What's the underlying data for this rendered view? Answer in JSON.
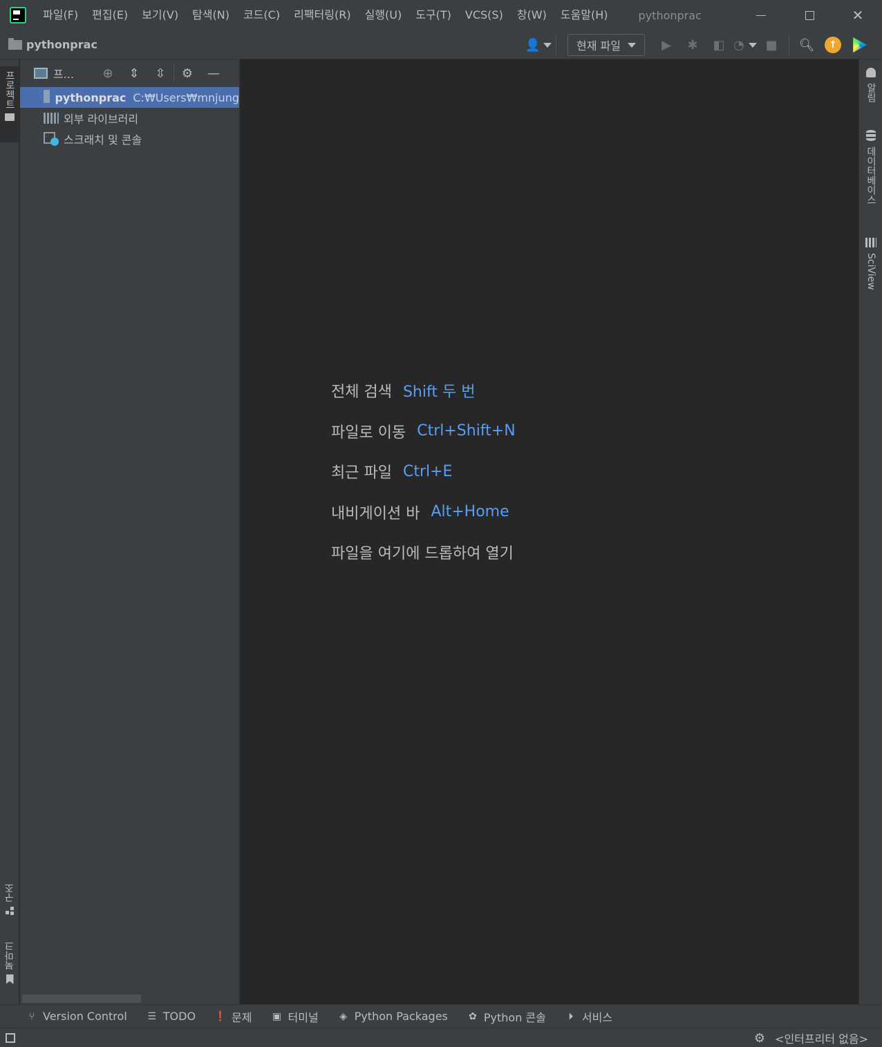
{
  "titlebar": {
    "menu": [
      "파일(F)",
      "편집(E)",
      "보기(V)",
      "탐색(N)",
      "코드(C)",
      "리팩터링(R)",
      "실행(U)",
      "도구(T)",
      "VCS(S)",
      "창(W)",
      "도움말(H)"
    ],
    "window_title": "pythonprac"
  },
  "navbar": {
    "project_name": "pythonprac",
    "run_config": "현재 파일"
  },
  "left_strip": {
    "project_tab": "프로젝트",
    "structure_tab": "구조",
    "bookmarks_tab": "북마크"
  },
  "project_panel": {
    "title": "프...",
    "tree": [
      {
        "name": "pythonprac",
        "path": "C:₩Users₩mnjung"
      },
      {
        "name": "외부 라이브러리"
      },
      {
        "name": "스크래치 및 콘솔"
      }
    ]
  },
  "editor": {
    "hints": [
      {
        "label": "전체 검색",
        "shortcut": "Shift 두 번"
      },
      {
        "label": "파일로 이동",
        "shortcut": "Ctrl+Shift+N"
      },
      {
        "label": "최근 파일",
        "shortcut": "Ctrl+E"
      },
      {
        "label": "내비게이션 바",
        "shortcut": "Alt+Home"
      },
      {
        "label": "파일을 여기에 드롭하여 열기",
        "shortcut": ""
      }
    ]
  },
  "right_strip": {
    "notifications_tab": "알림",
    "database_tab": "데이터베이스",
    "sciview_tab": "SciView"
  },
  "bottom_bar": {
    "tabs": [
      "Version Control",
      "TODO",
      "문제",
      "터미널",
      "Python Packages",
      "Python 콘솔",
      "서비스"
    ]
  },
  "status_bar": {
    "interpreter": "<인터프리터 없음>"
  }
}
